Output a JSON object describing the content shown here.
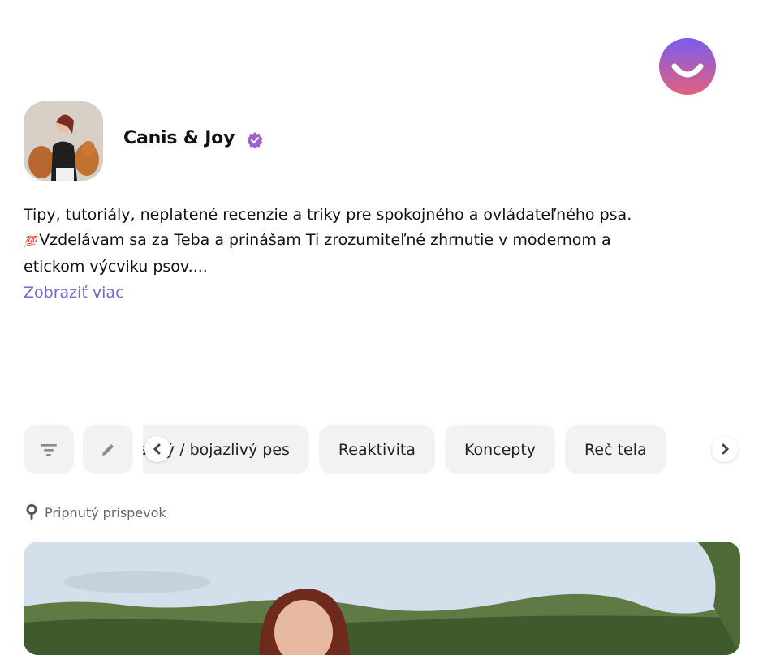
{
  "brand": {
    "logo_icon": "smile-logo-icon",
    "accent": "#7b5cd6"
  },
  "profile": {
    "name": "Canis & Joy",
    "verified_icon": "verified-badge-icon",
    "verified_color": "#9a63d1",
    "avatar_alt": "profile-photo"
  },
  "bio": {
    "line1": "Tipy, tutoriály, neplatené recenzie a triky pre spokojného a ovládateľného psa.",
    "emoji": "💯",
    "line2": "Vzdelávam sa za Teba a prinášam Ti zrozumiteľné zhrnutie v modernom a",
    "line3": "etickom výcviku psov....",
    "more_label": "Zobraziť viac",
    "more_color": "#6e6ad6"
  },
  "toolbar": {
    "filter_icon": "filter-icon",
    "edit_icon": "pencil-icon",
    "prev_icon": "chevron-left-icon",
    "next_icon": "chevron-right-icon"
  },
  "tabs": [
    {
      "label": "Plachý / bojazlivý pes"
    },
    {
      "label": "Reaktivita"
    },
    {
      "label": "Koncepty"
    },
    {
      "label": "Reč tela"
    }
  ],
  "pinned": {
    "icon": "pin-icon",
    "label": "Pripnutý príspevok"
  }
}
